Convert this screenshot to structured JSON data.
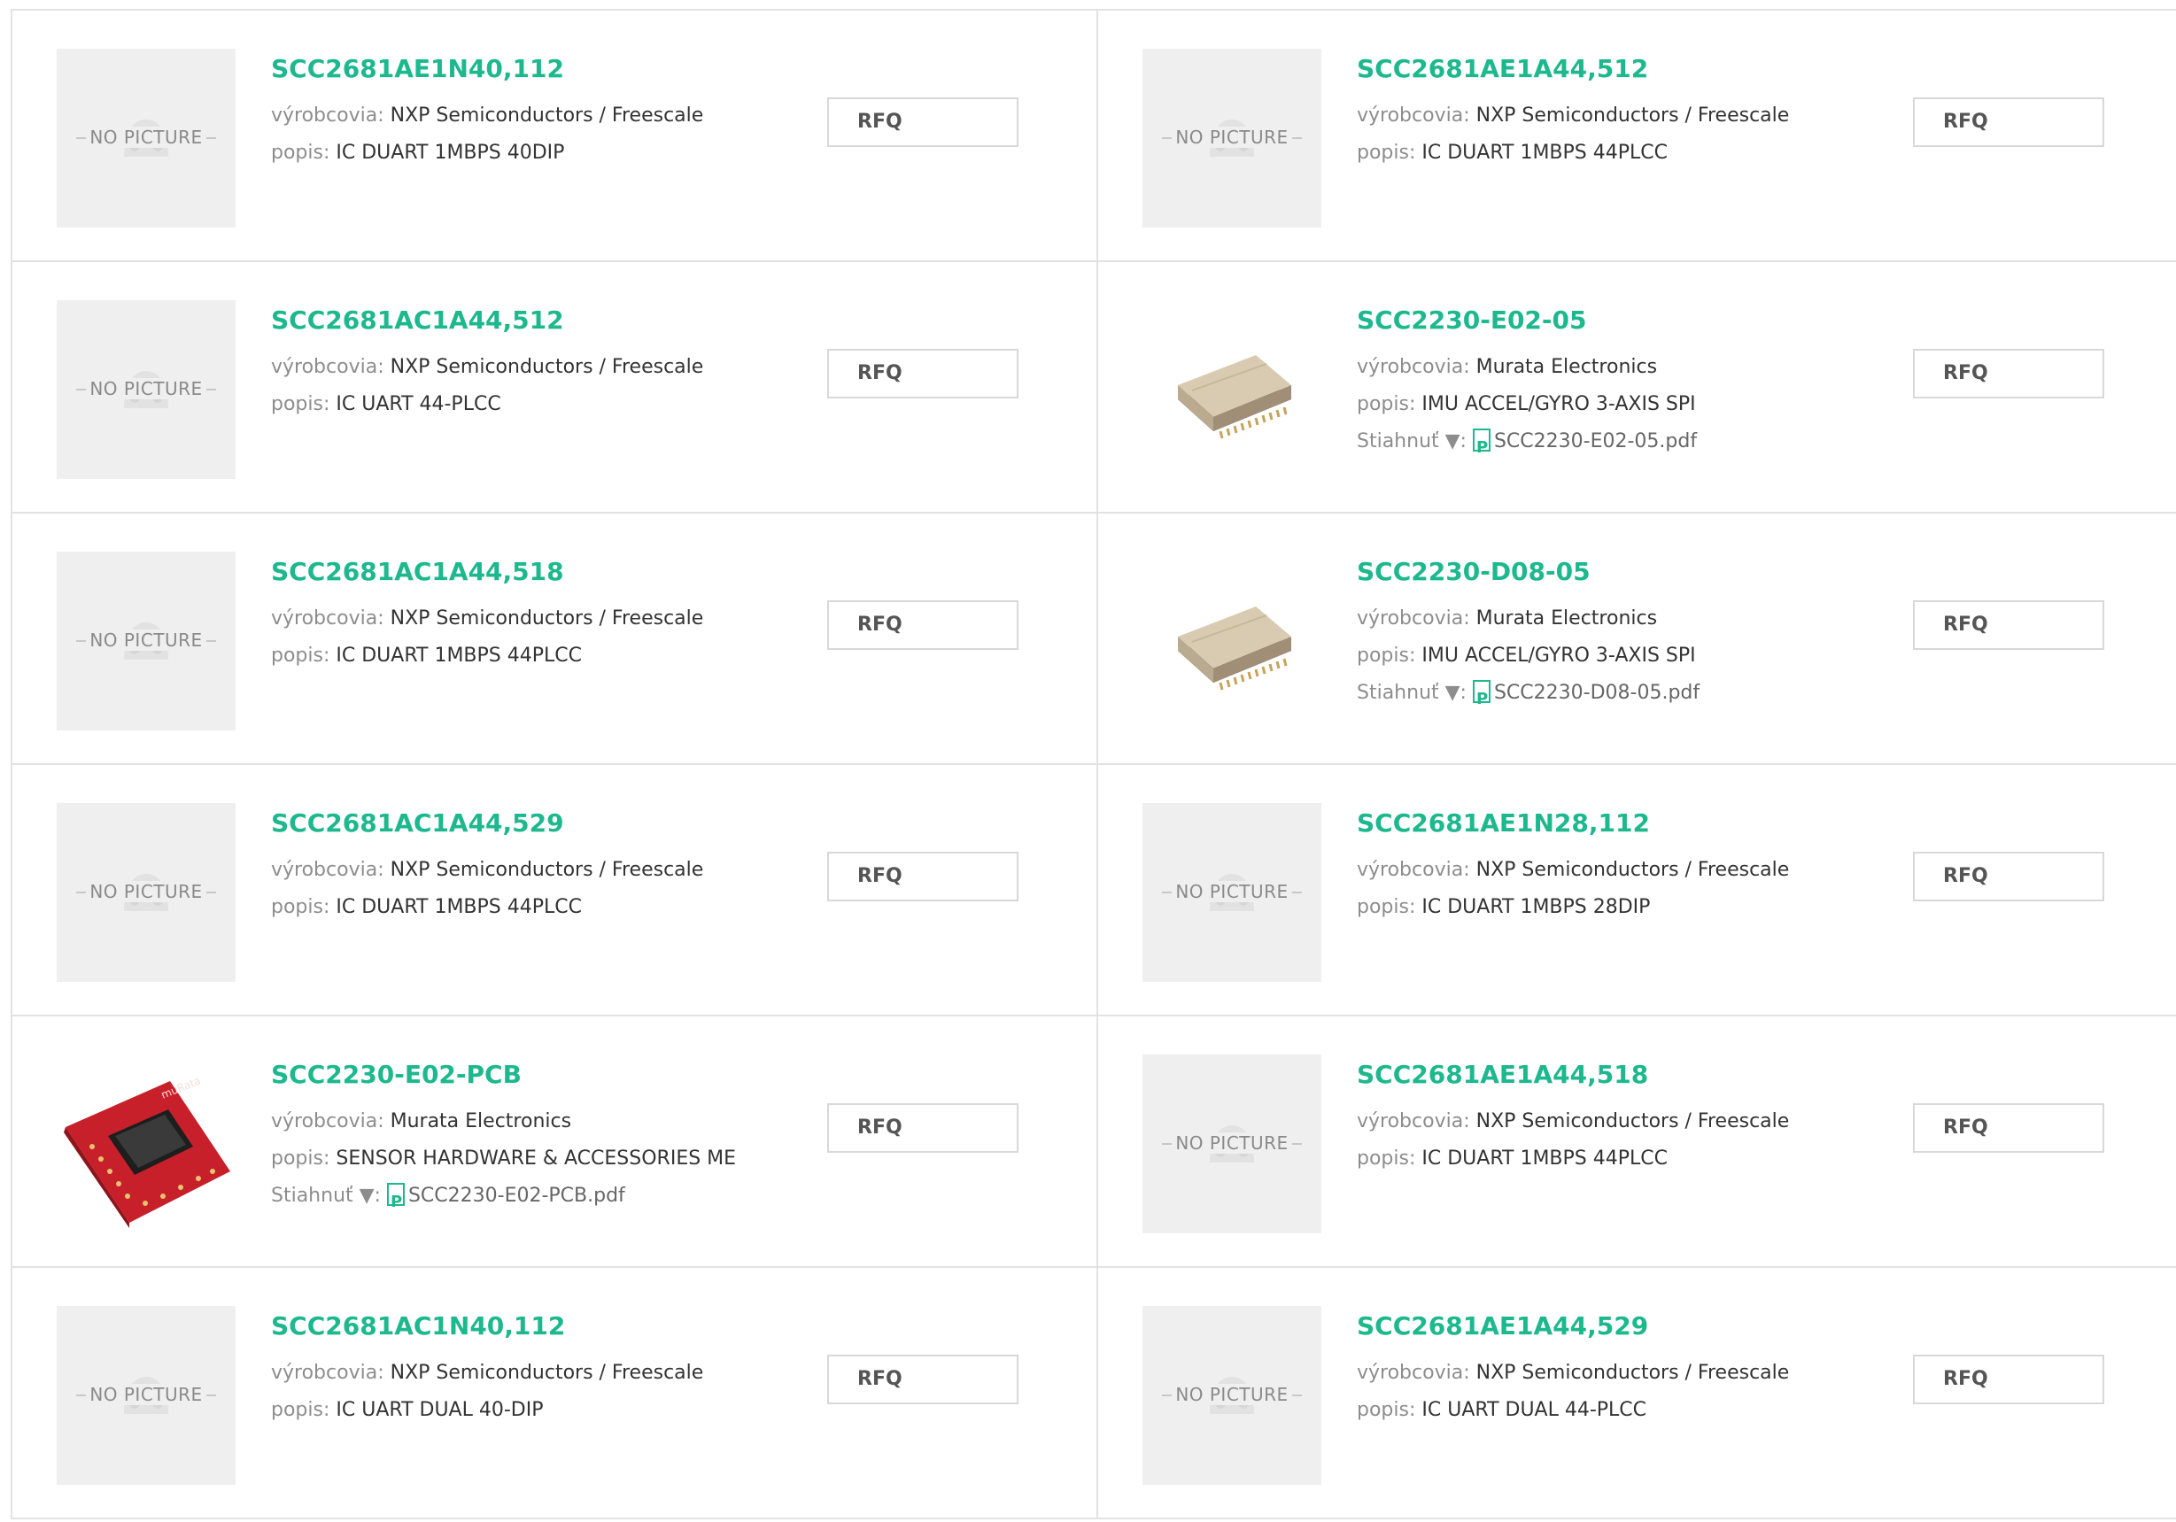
{
  "labels": {
    "manufacturer": "výrobcovia:",
    "description": "popis:",
    "download": "Stiahnuť ▼:"
  },
  "no_picture_text": "NO PICTURE",
  "rfq_label": "RFQ",
  "colors": {
    "part_link": "#1db88e",
    "label_gray": "#8d8d8d",
    "value_dark": "#333333",
    "border": "#e2e2e2"
  },
  "items": [
    {
      "part": "SCC2681AE1N40,112",
      "manufacturer": "NXP Semiconductors / Freescale",
      "description": "IC DUART 1MBPS 40DIP",
      "image": "no-picture"
    },
    {
      "part": "SCC2681AE1A44,512",
      "manufacturer": "NXP Semiconductors / Freescale",
      "description": "IC DUART 1MBPS 44PLCC",
      "image": "no-picture"
    },
    {
      "part": "SCC2681AC1A44,512",
      "manufacturer": "NXP Semiconductors / Freescale",
      "description": "IC UART 44-PLCC",
      "image": "no-picture"
    },
    {
      "part": "SCC2230-E02-05",
      "manufacturer": "Murata Electronics",
      "description": "IMU ACCEL/GYRO 3-AXIS SPI",
      "image": "chip-photo",
      "pdf": "SCC2230-E02-05.pdf"
    },
    {
      "part": "SCC2681AC1A44,518",
      "manufacturer": "NXP Semiconductors / Freescale",
      "description": "IC DUART 1MBPS 44PLCC",
      "image": "no-picture"
    },
    {
      "part": "SCC2230-D08-05",
      "manufacturer": "Murata Electronics",
      "description": "IMU ACCEL/GYRO 3-AXIS SPI",
      "image": "chip-photo",
      "pdf": "SCC2230-D08-05.pdf"
    },
    {
      "part": "SCC2681AC1A44,529",
      "manufacturer": "NXP Semiconductors / Freescale",
      "description": "IC DUART 1MBPS 44PLCC",
      "image": "no-picture"
    },
    {
      "part": "SCC2681AE1N28,112",
      "manufacturer": "NXP Semiconductors / Freescale",
      "description": "IC DUART 1MBPS 28DIP",
      "image": "no-picture"
    },
    {
      "part": "SCC2230-E02-PCB",
      "manufacturer": "Murata Electronics",
      "description": "SENSOR HARDWARE & ACCESSORIES ME",
      "image": "pcb-photo",
      "pdf": "SCC2230-E02-PCB.pdf"
    },
    {
      "part": "SCC2681AE1A44,518",
      "manufacturer": "NXP Semiconductors / Freescale",
      "description": "IC DUART 1MBPS 44PLCC",
      "image": "no-picture"
    },
    {
      "part": "SCC2681AC1N40,112",
      "manufacturer": "NXP Semiconductors / Freescale",
      "description": "IC UART DUAL 40-DIP",
      "image": "no-picture"
    },
    {
      "part": "SCC2681AE1A44,529",
      "manufacturer": "NXP Semiconductors / Freescale",
      "description": "IC UART DUAL 44-PLCC",
      "image": "no-picture"
    }
  ]
}
